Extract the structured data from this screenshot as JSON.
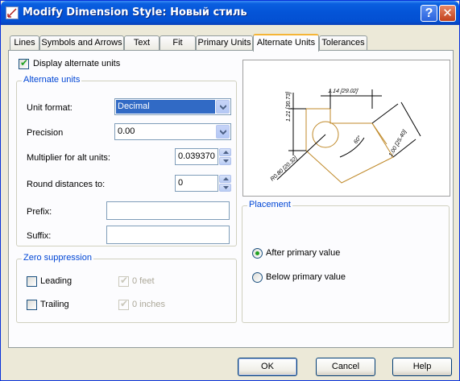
{
  "window": {
    "title": "Modify Dimension Style: Новый стиль",
    "help_icon": "question-icon",
    "close_icon": "close-icon"
  },
  "tabs": [
    {
      "label": "Lines"
    },
    {
      "label": "Symbols and Arrows"
    },
    {
      "label": "Text"
    },
    {
      "label": "Fit"
    },
    {
      "label": "Primary Units"
    },
    {
      "label": "Alternate Units",
      "active": true
    },
    {
      "label": "Tolerances"
    }
  ],
  "display_alt": {
    "label": "Display alternate units",
    "checked": true
  },
  "alt_units": {
    "group_label": "Alternate units",
    "unit_format_label": "Unit format:",
    "unit_format_value": "Decimal",
    "precision_label": "Precision",
    "precision_value": "0.00",
    "multiplier_label": "Multiplier for alt units:",
    "multiplier_value": "0.039370",
    "round_label": "Round distances  to:",
    "round_value": "0",
    "prefix_label": "Prefix:",
    "prefix_value": "",
    "suffix_label": "Suffix:",
    "suffix_value": ""
  },
  "zero_suppression": {
    "group_label": "Zero suppression",
    "leading": {
      "label": "Leading",
      "checked": false
    },
    "trailing": {
      "label": "Trailing",
      "checked": false
    },
    "feet": {
      "label": "0 feet",
      "checked": true,
      "disabled": true
    },
    "inches": {
      "label": "0 inches",
      "checked": true,
      "disabled": true
    }
  },
  "preview_labels": {
    "top_dim": "1.14 [29.02]",
    "left_dim": "1.21 [30.73]",
    "right_dim": "1.00 [25.40]",
    "radius": "R0.80 [20.32]",
    "angle": "60°"
  },
  "placement": {
    "group_label": "Placement",
    "after": {
      "label": "After primary value",
      "selected": true
    },
    "below": {
      "label": "Below primary value",
      "selected": false
    }
  },
  "buttons": {
    "ok": "OK",
    "cancel": "Cancel",
    "help": "Help"
  },
  "colors": {
    "titlebar": "#0454d7",
    "accent_text": "#0046d5",
    "preview_geometry": "#c08a2a"
  }
}
